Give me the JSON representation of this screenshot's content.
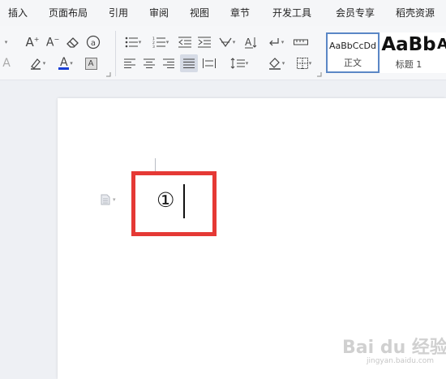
{
  "menu": {
    "tabs": [
      {
        "label": "插入"
      },
      {
        "label": "页面布局"
      },
      {
        "label": "引用"
      },
      {
        "label": "审阅"
      },
      {
        "label": "视图"
      },
      {
        "label": "章节"
      },
      {
        "label": "开发工具"
      },
      {
        "label": "会员专享"
      },
      {
        "label": "稻壳资源"
      }
    ]
  },
  "ribbon": {
    "font": {
      "grow_label": "A",
      "shrink_label": "A",
      "text_effect_label": "A",
      "font_color_label": "A",
      "char_shading_label": "A",
      "font_color": "#1a3fd6"
    },
    "styles": {
      "normal": {
        "preview": "AaBbCcDd",
        "caption": "正文"
      },
      "heading1": {
        "preview": "AaBb",
        "caption": "标题 1"
      },
      "heading2": {
        "preview": "A"
      }
    }
  },
  "document": {
    "content": "①"
  },
  "watermark": {
    "text": "Bai du 经验",
    "sub": "jingyan.baidu.com"
  },
  "colors": {
    "highlight_border": "#e53935",
    "selected_style_border": "#5b87c6"
  }
}
